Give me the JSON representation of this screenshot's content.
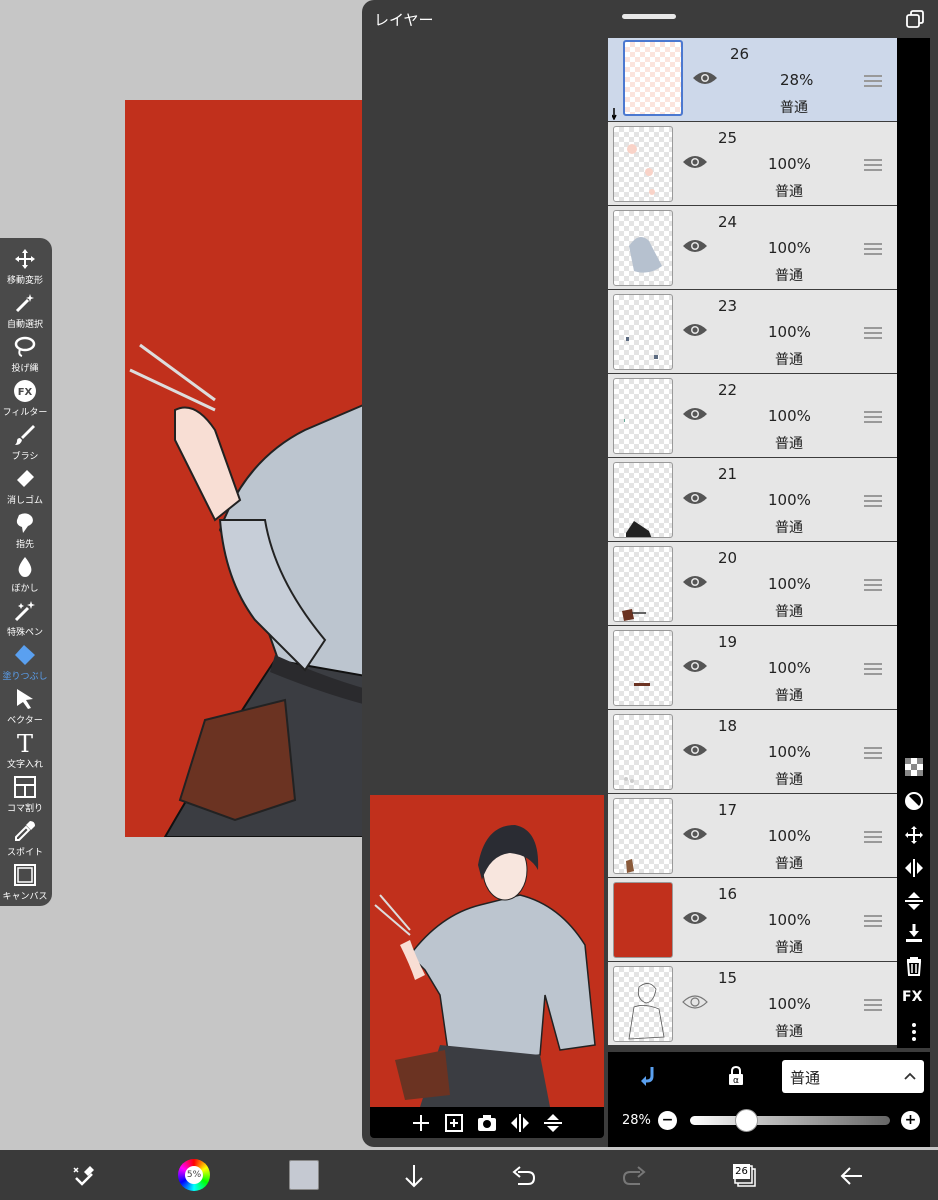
{
  "colors": {
    "canvas_red": "#c1301c",
    "panel_bg": "#3c3c3c",
    "accent_blue": "#4b78d0",
    "active_tool": "#5aa0f0"
  },
  "tools": [
    {
      "label": "移動変形",
      "icon": "move-icon"
    },
    {
      "label": "自動選択",
      "icon": "magic-wand-icon"
    },
    {
      "label": "投げ縄",
      "icon": "lasso-icon"
    },
    {
      "label": "フィルター",
      "icon": "filter-fx-icon",
      "glyph": "FX"
    },
    {
      "label": "ブラシ",
      "icon": "brush-icon"
    },
    {
      "label": "消しゴム",
      "icon": "eraser-icon"
    },
    {
      "label": "指先",
      "icon": "smudge-icon"
    },
    {
      "label": "ぼかし",
      "icon": "blur-drop-icon"
    },
    {
      "label": "特殊ペン",
      "icon": "special-pen-icon"
    },
    {
      "label": "塗りつぶし",
      "icon": "fill-bucket-icon",
      "active": true
    },
    {
      "label": "ベクター",
      "icon": "vector-cursor-icon"
    },
    {
      "label": "文字入れ",
      "icon": "text-icon",
      "glyph": "T"
    },
    {
      "label": "コマ割り",
      "icon": "frame-divider-icon"
    },
    {
      "label": "スポイト",
      "icon": "eyedropper-icon"
    },
    {
      "label": "キャンバス",
      "icon": "canvas-icon"
    }
  ],
  "layer_panel": {
    "title": "レイヤー",
    "layers": [
      {
        "number": "26",
        "opacity": "28%",
        "blend": "普通",
        "selected": true,
        "visible": true,
        "clipped": true
      },
      {
        "number": "25",
        "opacity": "100%",
        "blend": "普通",
        "visible": true
      },
      {
        "number": "24",
        "opacity": "100%",
        "blend": "普通",
        "visible": true
      },
      {
        "number": "23",
        "opacity": "100%",
        "blend": "普通",
        "visible": true
      },
      {
        "number": "22",
        "opacity": "100%",
        "blend": "普通",
        "visible": true
      },
      {
        "number": "21",
        "opacity": "100%",
        "blend": "普通",
        "visible": true
      },
      {
        "number": "20",
        "opacity": "100%",
        "blend": "普通",
        "visible": true
      },
      {
        "number": "19",
        "opacity": "100%",
        "blend": "普通",
        "visible": true
      },
      {
        "number": "18",
        "opacity": "100%",
        "blend": "普通",
        "visible": true
      },
      {
        "number": "17",
        "opacity": "100%",
        "blend": "普通",
        "visible": true
      },
      {
        "number": "16",
        "opacity": "100%",
        "blend": "普通",
        "visible": true
      },
      {
        "number": "15",
        "opacity": "100%",
        "blend": "普通",
        "visible": false
      }
    ],
    "blend_mode": "普通",
    "opacity_label": "28%",
    "opacity_value": 0.28,
    "fx_label": "FX",
    "minus_label": "−",
    "plus_label": "+"
  },
  "bottom_bar": {
    "color_wheel_label": "5%",
    "layer_count": "26"
  }
}
